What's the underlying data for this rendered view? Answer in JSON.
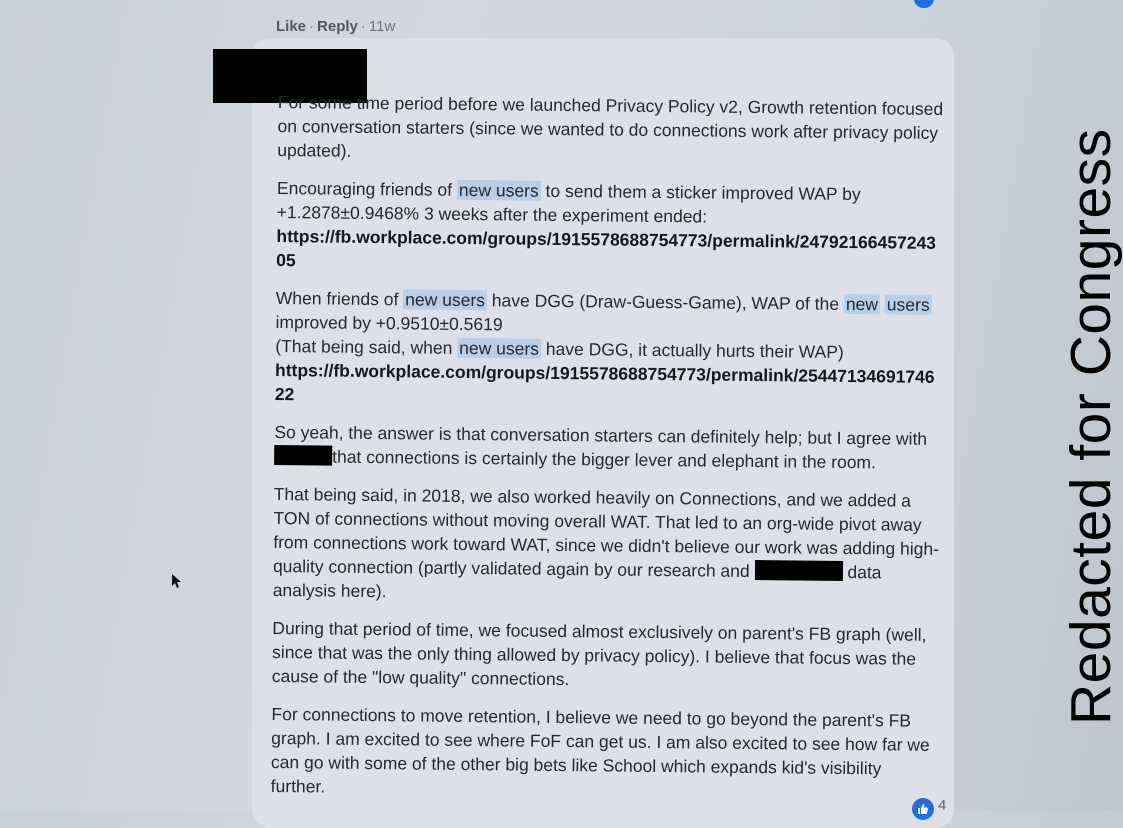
{
  "comment_meta": {
    "like": "Like",
    "reply": "Reply",
    "separator": "·",
    "time": "11w"
  },
  "paragraphs": {
    "p1": "For some time period before we launched Privacy Policy v2, Growth retention focused on conversation starters (since we wanted to do connections work after privacy policy updated).",
    "p2_a": "Encouraging friends of ",
    "p2_b": " to send them a sticker improved WAP by +1.2878±0.9468% 3 weeks after the experiment ended:",
    "link1": "https://fb.workplace.com/groups/1915578688754773/permalink/2479216645724305",
    "p3_a": "When friends of ",
    "p3_b": " have DGG (Draw-Guess-Game), WAP of the ",
    "p3_c": " improved by +0.9510±0.5619",
    "p3_d": "(That being said, when ",
    "p3_e": " have DGG, it actually hurts their WAP)",
    "link2": "https://fb.workplace.com/groups/1915578688754773/permalink/2544713469174622",
    "p4_a": "So yeah, the answer is that conversation starters can definitely help; but I agree with",
    "p4_b": "that connections is certainly the bigger lever and elephant in the room.",
    "p5_a": "That being said, in 2018, we also worked heavily on Connections, and we added a TON of connections without moving overall WAT. That led to an org-wide pivot away from connections work toward WAT, since we didn't believe our work was adding high-quality connection (partly validated again by our research and",
    "p5_b": "data analysis here).",
    "p6": "During that period of time, we focused almost exclusively on parent's FB graph (well, since that was the only thing allowed by privacy policy). I believe that focus was the cause of the \"low quality\" connections.",
    "p7": "For connections to move retention, I believe we need to go beyond the parent's FB graph. I am excited to see where FoF can get us. I am also excited to see how far we can go with some of the other big bets like School which expands kid's visibility further."
  },
  "highlight": {
    "new_users": "new users",
    "new": "new",
    "users": "users"
  },
  "reaction_count": "4",
  "stamp": "Redacted for Congress",
  "colors": {
    "highlight": "#b9cfe8",
    "link": "#15181c",
    "redaction": "#000000",
    "reaction": "#1e6fe0"
  },
  "icons": [
    "thumbs-up-icon",
    "mouse-cursor-icon"
  ]
}
